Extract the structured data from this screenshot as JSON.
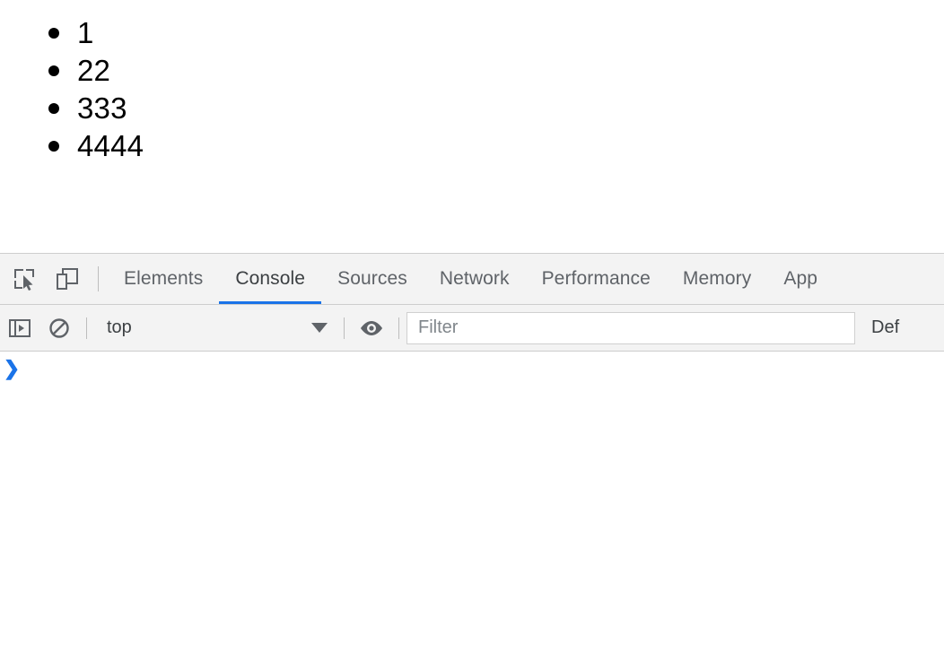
{
  "page": {
    "list_items": [
      {
        "text": "1"
      },
      {
        "text": "22"
      },
      {
        "text": "333"
      },
      {
        "text": "4444"
      }
    ]
  },
  "devtools": {
    "toolbar_icons": [
      {
        "name": "inspect-element-icon",
        "label": "Inspect element"
      },
      {
        "name": "device-toolbar-icon",
        "label": "Toggle device toolbar"
      }
    ],
    "tabs": [
      {
        "label": "Elements",
        "selected": false
      },
      {
        "label": "Console",
        "selected": true
      },
      {
        "label": "Sources",
        "selected": false
      },
      {
        "label": "Network",
        "selected": false
      },
      {
        "label": "Performance",
        "selected": false
      },
      {
        "label": "Memory",
        "selected": false
      },
      {
        "label": "App",
        "selected": false
      }
    ],
    "console_toolbar": {
      "sidebar_toggle_icon": "console-sidebar-icon",
      "clear_console_icon": "clear-console-icon",
      "context_selector_value": "top",
      "context_caret_icon": "chevron-down-icon",
      "live_expression_icon": "eye-icon",
      "filter_placeholder": "Filter",
      "filter_value": "",
      "level_selector_label": "Def"
    },
    "console_body": {
      "prompt_chevron": "❯",
      "prompt_value": ""
    },
    "colors": {
      "accent": "#1a73e8",
      "toolbar_bg": "#f3f3f3",
      "border": "#cdcdcd",
      "text": "#5f6368"
    }
  }
}
